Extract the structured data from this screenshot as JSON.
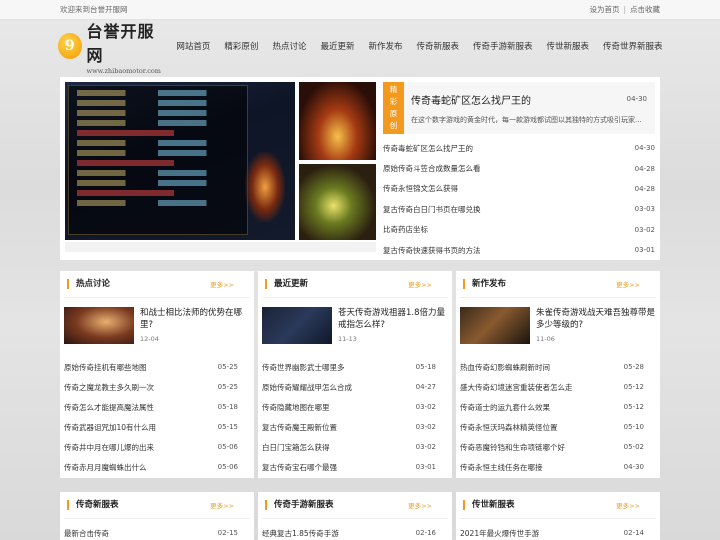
{
  "topbar": {
    "welcome": "欢迎来到台誉开服网",
    "set_home": "设为首页",
    "separator": "|",
    "bookmark": "点击收藏"
  },
  "logo": {
    "badge": "9",
    "name": "台誉开服网",
    "url": "www.zhibaomotor.com"
  },
  "nav": [
    "网站首页",
    "精彩原创",
    "热点讨论",
    "最近更新",
    "新作发布",
    "传奇新服表",
    "传奇手游新服表",
    "传世新服表",
    "传奇世界新服表"
  ],
  "feature": {
    "tag": [
      "精",
      "彩",
      "原",
      "创"
    ],
    "headline": {
      "title": "传奇毒蛇矿区怎么找尸王的",
      "date": "04-30",
      "summary": "在这个数字游戏的黄金时代，每一款游戏都试图以其独特的方式吸引玩家..."
    },
    "list": [
      {
        "title": "传奇毒蛇矿区怎么找尸王的",
        "date": "04-30"
      },
      {
        "title": "原始传奇斗笠合成数量怎么看",
        "date": "04-28"
      },
      {
        "title": "传奇永恒锦文怎么获得",
        "date": "04-28"
      },
      {
        "title": "复古传奇白日门书页在哪兑换",
        "date": "03-03"
      },
      {
        "title": "比奇药店坐标",
        "date": "03-02"
      },
      {
        "title": "复古传奇快速获得书页的方法",
        "date": "03-01"
      }
    ]
  },
  "sections": [
    {
      "title": "热点讨论",
      "more": "更多>>",
      "card": {
        "title": "和战士相比法师的优势在哪里?",
        "date": "12-04"
      },
      "items": [
        {
          "title": "原始传奇挂机有哪些地图",
          "date": "05-25"
        },
        {
          "title": "传奇之魔龙教主多久刷一次",
          "date": "05-25"
        },
        {
          "title": "传奇怎么才能提高魔法属性",
          "date": "05-18"
        },
        {
          "title": "传奇武器诅咒加10有什么用",
          "date": "05-15"
        },
        {
          "title": "传奇井中月在哪儿爆的出来",
          "date": "05-06"
        },
        {
          "title": "传奇赤月月魔蜘蛛出什么",
          "date": "05-06"
        }
      ]
    },
    {
      "title": "最近更新",
      "more": "更多>>",
      "card": {
        "title": "苍天传奇游戏祖器1.8倍力量戒指怎么样?",
        "date": "11-13"
      },
      "items": [
        {
          "title": "传奇世界幽影武士哪里多",
          "date": "05-18"
        },
        {
          "title": "原始传奇耀耀战甲怎么合成",
          "date": "04-27"
        },
        {
          "title": "传奇隐藏地图在哪里",
          "date": "03-02"
        },
        {
          "title": "复古传奇魔王殿新位置",
          "date": "03-02"
        },
        {
          "title": "白日门宝箱怎么获得",
          "date": "03-02"
        },
        {
          "title": "复古传奇宝石哪个最强",
          "date": "03-01"
        }
      ]
    },
    {
      "title": "新作发布",
      "more": "更多>>",
      "card": {
        "title": "朱雀传奇游戏战天难吾独尊带是多少等级的?",
        "date": "11-06"
      },
      "items": [
        {
          "title": "热血传奇幻影蜘蛛刷新时间",
          "date": "05-28"
        },
        {
          "title": "盛大传奇幻境迷宫重装使者怎么走",
          "date": "05-12"
        },
        {
          "title": "传奇道士的运九套什么效果",
          "date": "05-12"
        },
        {
          "title": "传奇永恒沃玛森林精英怪位置",
          "date": "05-10"
        },
        {
          "title": "传奇恶魔铃铛和生命项链哪个好",
          "date": "05-02"
        },
        {
          "title": "传奇永恒主线任务在哪接",
          "date": "04-30"
        }
      ]
    },
    {
      "title": "传奇新服表",
      "more": "更多>>",
      "items": [
        {
          "title": "最新合击传奇",
          "date": "02-15"
        }
      ]
    },
    {
      "title": "传奇手游新服表",
      "more": "更多>>",
      "items": [
        {
          "title": "经典复古1.85传奇手游",
          "date": "02-16"
        }
      ]
    },
    {
      "title": "传世新服表",
      "more": "更多>>",
      "items": [
        {
          "title": "2021年最火爆传世手游",
          "date": "02-14"
        }
      ]
    }
  ],
  "colors": {
    "accent": "#f39a1e",
    "panel": "#ffffff"
  }
}
